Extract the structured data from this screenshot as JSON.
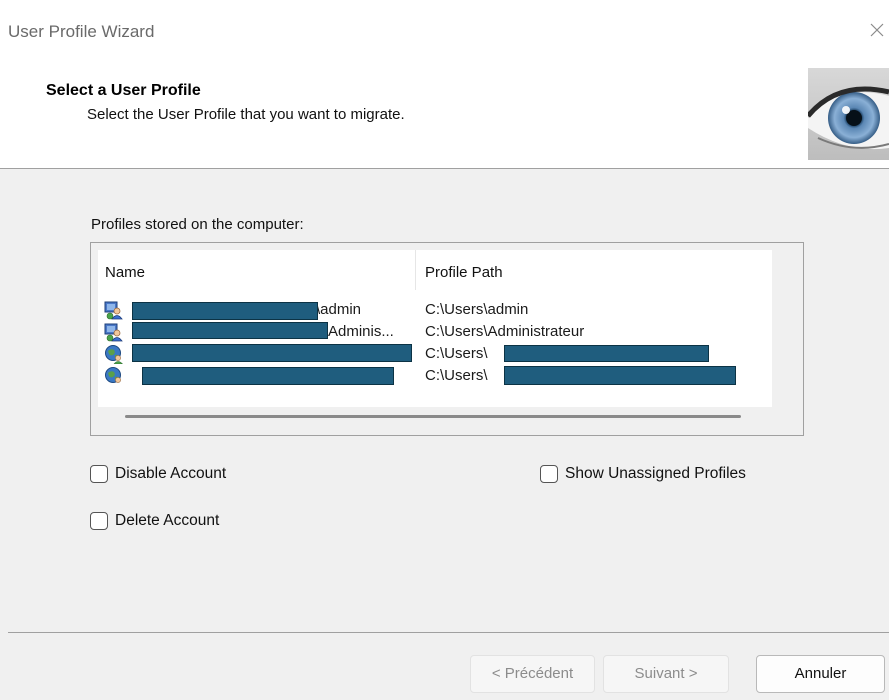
{
  "window": {
    "title": "User Profile Wizard"
  },
  "header": {
    "title": "Select a User Profile",
    "subtitle": "Select the User Profile that you want to migrate."
  },
  "profiles": {
    "label": "Profiles stored on the computer:",
    "columns": {
      "name": "Name",
      "path": "Profile Path"
    },
    "rows": [
      {
        "icon": "domain-user-icon",
        "name": "\\admin",
        "path": "C:\\Users\\admin"
      },
      {
        "icon": "domain-user-icon",
        "name": "Adminis...",
        "path": "C:\\Users\\Administrateur"
      },
      {
        "icon": "globe-user-icon",
        "name": "",
        "path": "C:\\Users\\"
      },
      {
        "icon": "globe-user-icon",
        "name": "",
        "path": "C:\\Users\\"
      }
    ]
  },
  "options": {
    "disable_account": "Disable Account",
    "show_unassigned": "Show Unassigned Profiles",
    "delete_account": "Delete Account"
  },
  "buttons": {
    "previous": "< Précédent",
    "next": "Suivant >",
    "cancel": "Annuler"
  },
  "colors": {
    "redaction": "#1f5d7e",
    "window_bg": "#f0f0f0"
  }
}
